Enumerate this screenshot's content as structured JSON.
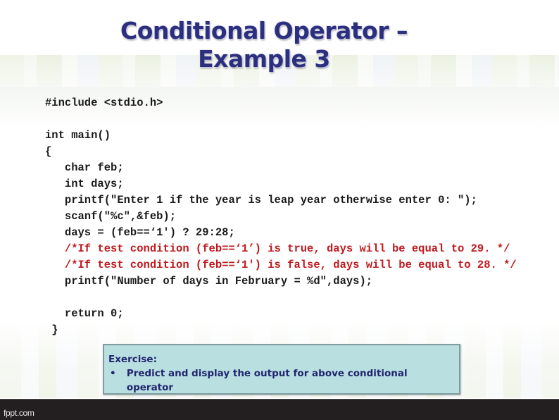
{
  "slide": {
    "title_line1": "Conditional Operator –",
    "title_line2": "Example 3",
    "code_lines": [
      {
        "text": "#include <stdio.h>",
        "type": "code"
      },
      {
        "text": "",
        "type": "code"
      },
      {
        "text": "int main()",
        "type": "code"
      },
      {
        "text": "{",
        "type": "code"
      },
      {
        "text": "   char feb;",
        "type": "code"
      },
      {
        "text": "   int days;",
        "type": "code"
      },
      {
        "text": "   printf(\"Enter 1 if the year is leap year otherwise enter 0: \");",
        "type": "code"
      },
      {
        "text": "   scanf(\"%c\",&feb);",
        "type": "code"
      },
      {
        "text": "   days = (feb==‘1') ? 29:28;",
        "type": "code"
      },
      {
        "text": "   /*If test condition (feb==‘1’) is true, days will be equal to 29. */",
        "type": "comment"
      },
      {
        "text": "   /*If test condition (feb==‘1') is false, days will be equal to 28. */",
        "type": "comment"
      },
      {
        "text": "   printf(\"Number of days in February = %d\",days);",
        "type": "code"
      },
      {
        "text": "",
        "type": "code"
      },
      {
        "text": "   return 0;",
        "type": "code"
      },
      {
        "text": " }",
        "type": "code"
      }
    ],
    "exercise": {
      "heading": "Exercise:",
      "bullet": "•",
      "item": "Predict and display the output  for above conditional operator"
    },
    "footer": {
      "brand": "fppt.com"
    }
  },
  "colors": {
    "title": "#2b2f7e",
    "comment": "#c0191e",
    "exercise_bg": "#b9dfe1",
    "exercise_text": "#21266e",
    "footer_bg": "#231f20"
  }
}
